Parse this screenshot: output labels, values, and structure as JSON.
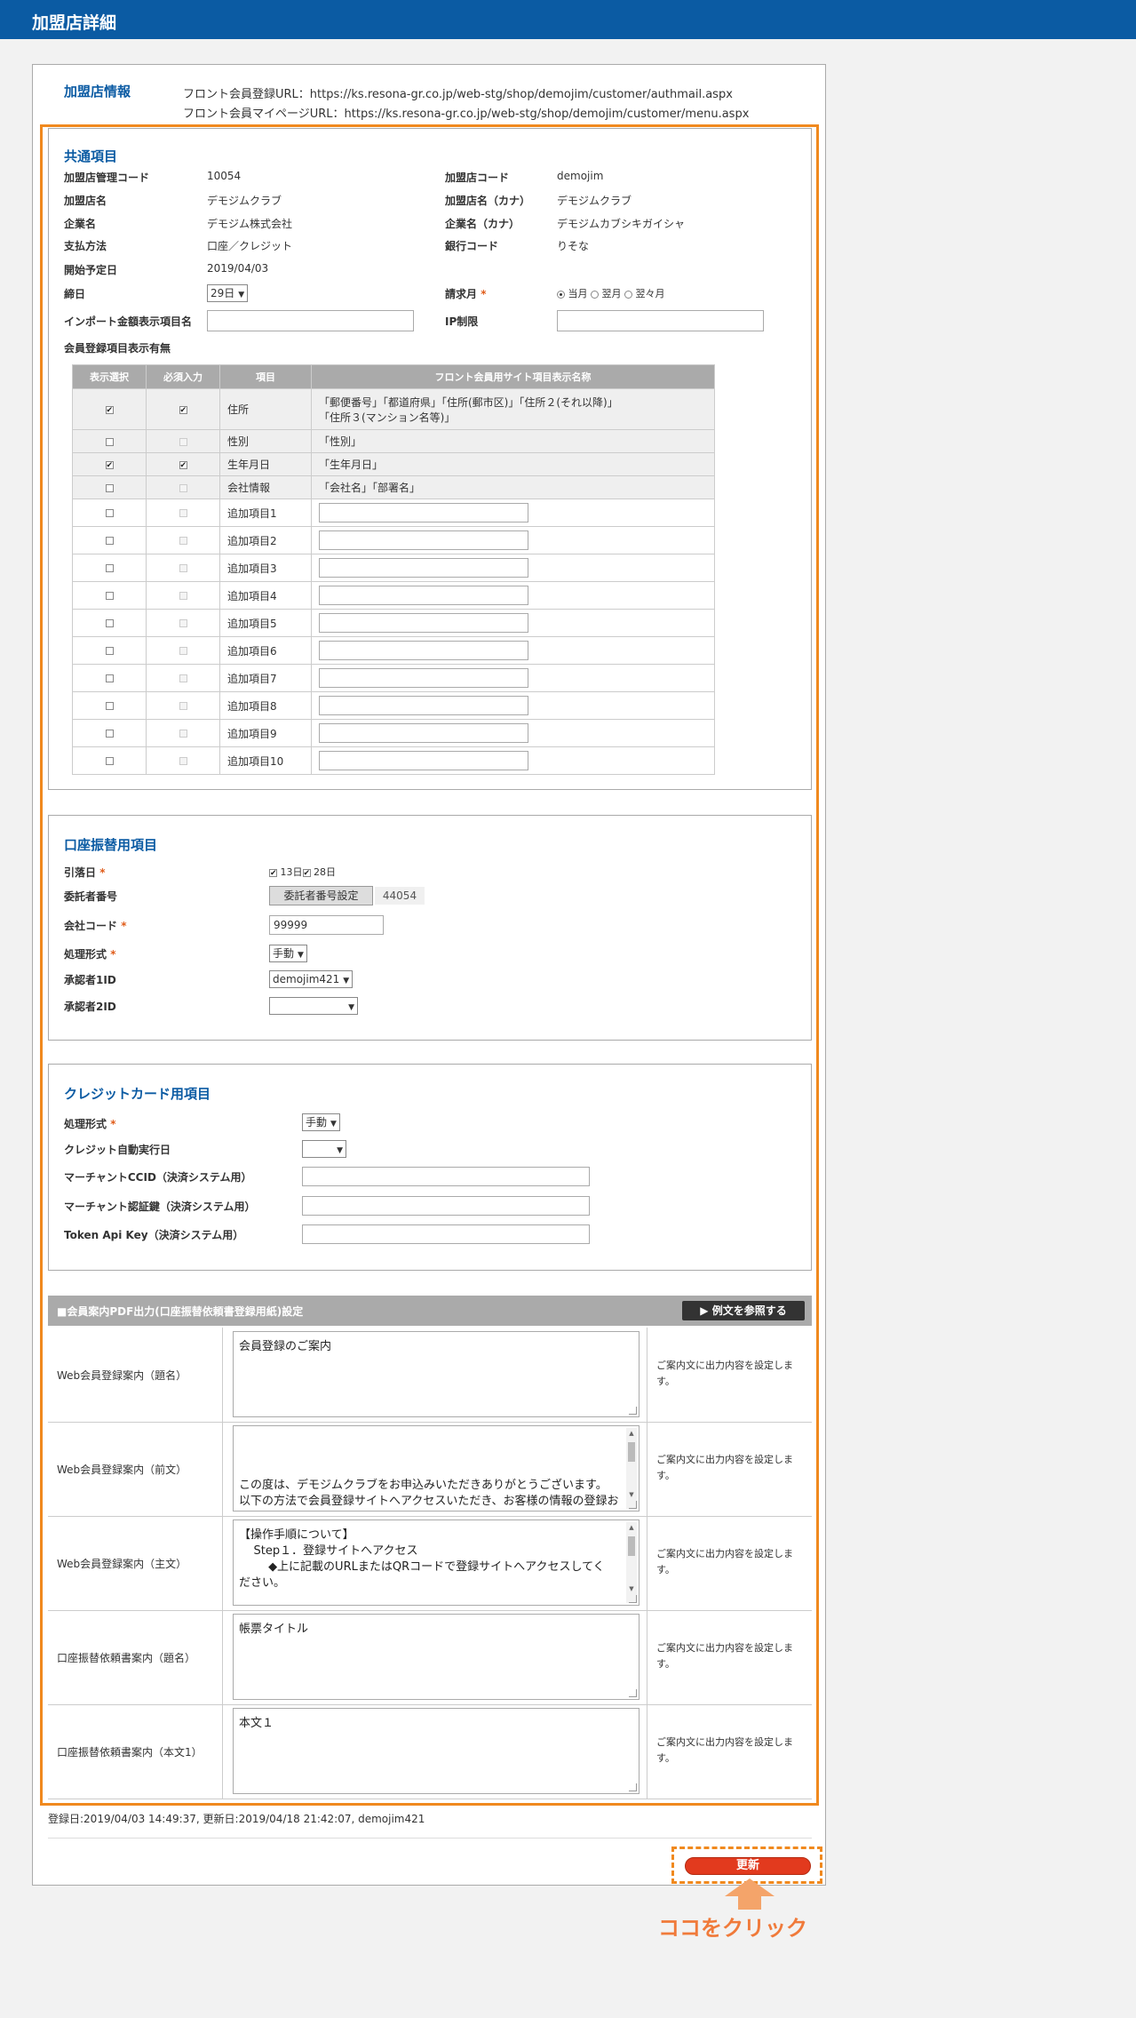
{
  "page_title": "加盟店詳細",
  "store_info": {
    "heading": "加盟店情報",
    "front_register_url": "フロント会員登録URL：https://ks.resona-gr.co.jp/web-stg/shop/demojim/customer/authmail.aspx",
    "front_mypage_url": "フロント会員マイページURL：https://ks.resona-gr.co.jp/web-stg/shop/demojim/customer/menu.aspx"
  },
  "common": {
    "heading": "共通項目",
    "fields": {
      "mgmt_code_label": "加盟店管理コード",
      "mgmt_code_value": "10054",
      "store_code_label": "加盟店コード",
      "store_code_value": "demojim",
      "store_name_label": "加盟店名",
      "store_name_value": "デモジムクラブ",
      "store_kana_label": "加盟店名（カナ）",
      "store_kana_value": "デモジムクラブ",
      "company_label": "企業名",
      "company_value": "デモジム株式会社",
      "company_kana_label": "企業名（カナ）",
      "company_kana_value": "デモジムカブシキガイシャ",
      "payment_label": "支払方法",
      "payment_value": "口座／クレジット",
      "bank_code_label": "銀行コード",
      "bank_code_value": "りそな",
      "start_label": "開始予定日",
      "start_value": "2019/04/03",
      "closing_label": "締日",
      "closing_value": "29日",
      "billing_label": "請求月",
      "billing_options": [
        "当月",
        "翌月",
        "翌々月"
      ],
      "import_label": "インポート金額表示項目名",
      "ip_label": "IP制限",
      "member_display_label": "会員登録項目表示有無"
    },
    "table": {
      "headers": [
        "表示選択",
        "必須入力",
        "項目",
        "フロント会員用サイト項目表示名称"
      ],
      "fixed_rows": [
        {
          "name": "住所",
          "display": "「郵便番号」「都道府県」「住所(郵市区)」「住所２(それ以降)」",
          "display2": "「住所３(マンション名等)」",
          "show": true,
          "req": true
        },
        {
          "name": "性別",
          "display": "「性別」",
          "display2": "",
          "show": false,
          "req": false
        },
        {
          "name": "生年月日",
          "display": "「生年月日」",
          "display2": "",
          "show": true,
          "req": true
        },
        {
          "name": "会社情報",
          "display": "「会社名」「部署名」",
          "display2": "",
          "show": false,
          "req": false
        }
      ],
      "extra_rows": [
        "追加項目1",
        "追加項目2",
        "追加項目3",
        "追加項目4",
        "追加項目5",
        "追加項目6",
        "追加項目7",
        "追加項目8",
        "追加項目9",
        "追加項目10"
      ]
    }
  },
  "bank": {
    "heading": "口座振替用項目",
    "withdraw_label": "引落日",
    "withdraw_13": "13日",
    "withdraw_28": "28日",
    "consignor_label": "委託者番号",
    "consignor_button": "委託者番号設定",
    "consignor_value": "44054",
    "company_code_label": "会社コード",
    "company_code_value": "99999",
    "process_label": "処理形式",
    "process_value": "手動",
    "approver1_label": "承認者1ID",
    "approver1_value": "demojim421",
    "approver2_label": "承認者2ID",
    "approver2_value": ""
  },
  "credit": {
    "heading": "クレジットカード用項目",
    "process_label": "処理形式",
    "process_value": "手動",
    "auto_label": "クレジット自動実行日",
    "auto_value": "",
    "ccid_label": "マーチャントCCID（決済システム用）",
    "auth_label": "マーチャント認証鍵（決済システム用）",
    "token_label": "Token Api Key（決済システム用）"
  },
  "pdf": {
    "title": "■会員案内PDF出力(口座振替依頼書登録用紙)設定",
    "example_button": "▶ 例文を参照する",
    "note": "ご案内文に出力内容を設定します。",
    "rows": [
      {
        "label": "Web会員登録案内（題名）",
        "text": "会員登録のご案内"
      },
      {
        "label": "Web会員登録案内（前文）",
        "text": "この度は、デモジムクラブをお申込みいただきありがとうございます。\n以下の方法で会員登録サイトへアクセスいただき、お客様の情報の登録およ"
      },
      {
        "label": "Web会員登録案内（主文）",
        "text": "【操作手順について】\n    Step１．登録サイトへアクセス\n        ◆上に記載のURLまたはQRコードで登録サイトへアクセスしてく\nださい。"
      },
      {
        "label": "口座振替依頼書案内（題名）",
        "text": "帳票タイトル"
      },
      {
        "label": "口座振替依頼書案内（本文1）",
        "text": "本文１"
      }
    ]
  },
  "footer": {
    "timestamps": "登録日:2019/04/03 14:49:37, 更新日:2019/04/18 21:42:07, demojim421",
    "submit_label": "更新",
    "click_hint": "ココをクリック"
  },
  "colors": {
    "header_blue": "#0b5ba3",
    "highlight_orange": "#f0891e",
    "submit_red": "#e23a1e"
  }
}
